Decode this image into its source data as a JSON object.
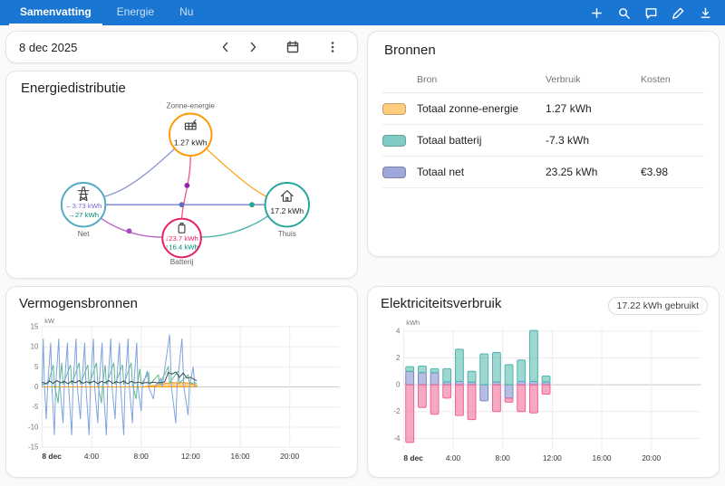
{
  "accent_color": "#1976d2",
  "topbar": {
    "tabs": [
      {
        "label": "Samenvatting",
        "active": true
      },
      {
        "label": "Energie",
        "active": false
      },
      {
        "label": "Nu",
        "active": false
      }
    ]
  },
  "date_bar": {
    "date": "8 dec 2025"
  },
  "energy_distribution": {
    "title": "Energiedistributie",
    "nodes": {
      "solar": {
        "label": "Zonne-energie",
        "value": "1.27 kWh",
        "color": "#ff9800"
      },
      "grid": {
        "label": "Net",
        "color": "#4fa8c4",
        "flows": [
          {
            "text": "←3.73 kWh",
            "color": "#7c66d9"
          },
          {
            "text": "→27 kWh",
            "color": "#00897b"
          }
        ]
      },
      "home": {
        "label": "Thuis",
        "value": "17.2 kWh",
        "color": "#26a69a"
      },
      "battery": {
        "label": "Batterij",
        "color": "#e91e63",
        "flows": [
          {
            "text": "↓23.7 kWh",
            "color": "#e91e63"
          },
          {
            "text": "↑16.4 kWh",
            "color": "#00897b"
          }
        ]
      }
    }
  },
  "sources": {
    "title": "Bronnen",
    "columns": [
      "Bron",
      "Verbruik",
      "Kosten"
    ],
    "rows": [
      {
        "name": "Totaal zonne-energie",
        "consumption": "1.27 kWh",
        "cost": "",
        "color": "#ffcc80"
      },
      {
        "name": "Totaal batterij",
        "consumption": "-7.3 kWh",
        "cost": "",
        "color": "#80cbc4"
      },
      {
        "name": "Totaal net",
        "consumption": "23.25 kWh",
        "cost": "€3.98",
        "color": "#9fa8da"
      }
    ]
  },
  "chart_data": [
    {
      "type": "line",
      "title": "Vermogensbronnen",
      "ylabel": "kW",
      "ylim": [
        -15,
        15
      ],
      "yticks": [
        15,
        10,
        5,
        0,
        -5,
        -10,
        -15
      ],
      "xlim": [
        0,
        24
      ],
      "xticks": [
        {
          "hour": 0,
          "label": "8 dec",
          "bold": true
        },
        {
          "hour": 4,
          "label": "4:00"
        },
        {
          "hour": 8,
          "label": "8:00"
        },
        {
          "hour": 12,
          "label": "12:00"
        },
        {
          "hour": 16,
          "label": "16:00"
        },
        {
          "hour": 20,
          "label": "20:00"
        }
      ],
      "series": [
        {
          "name": "Zonne-energie",
          "color": "#ff9800",
          "fill": true,
          "points": [
            [
              0,
              0
            ],
            [
              8,
              0
            ],
            [
              8.5,
              0.15
            ],
            [
              9,
              0.35
            ],
            [
              9.5,
              0.6
            ],
            [
              10,
              0.9
            ],
            [
              10.5,
              1.1
            ],
            [
              11,
              1.0
            ],
            [
              11.5,
              1.1
            ],
            [
              12,
              0.8
            ],
            [
              12.5,
              0.5
            ]
          ]
        },
        {
          "name": "Thuis",
          "color": "#5bb884",
          "points": [
            [
              0,
              0.6
            ],
            [
              0.5,
              0.8
            ],
            [
              0.9,
              5.5
            ],
            [
              1.0,
              0.6
            ],
            [
              1.3,
              -4
            ],
            [
              1.4,
              0.6
            ],
            [
              1.6,
              6
            ],
            [
              1.7,
              0.6
            ],
            [
              2.3,
              5.5
            ],
            [
              2.4,
              0.6
            ],
            [
              3.0,
              6
            ],
            [
              3.1,
              0.6
            ],
            [
              3.7,
              5.5
            ],
            [
              3.8,
              0.6
            ],
            [
              4.4,
              6
            ],
            [
              4.5,
              0.6
            ],
            [
              4.8,
              -4
            ],
            [
              4.9,
              0.6
            ],
            [
              5.1,
              5.5
            ],
            [
              5.2,
              0.6
            ],
            [
              5.8,
              6
            ],
            [
              5.9,
              0.6
            ],
            [
              6.5,
              5.5
            ],
            [
              6.6,
              0.6
            ],
            [
              7.2,
              6
            ],
            [
              7.3,
              0.6
            ],
            [
              7.6,
              -3
            ],
            [
              7.7,
              0.6
            ],
            [
              7.9,
              4.5
            ],
            [
              8.0,
              0.6
            ],
            [
              8.6,
              3.5
            ],
            [
              8.7,
              0.6
            ],
            [
              9.4,
              3
            ],
            [
              9.5,
              0.7
            ],
            [
              10.2,
              5
            ],
            [
              10.3,
              1
            ],
            [
              11.0,
              4
            ],
            [
              11.1,
              1
            ],
            [
              11.8,
              3
            ],
            [
              11.9,
              1
            ],
            [
              12.5,
              1
            ]
          ]
        },
        {
          "name": "Batterij",
          "color": "#7ba3e0",
          "points": [
            [
              0,
              0
            ],
            [
              0.1,
              12
            ],
            [
              0.2,
              0
            ],
            [
              0.35,
              -8
            ],
            [
              0.45,
              0
            ],
            [
              0.7,
              11
            ],
            [
              0.8,
              0
            ],
            [
              1.0,
              -12
            ],
            [
              1.1,
              0
            ],
            [
              1.35,
              12
            ],
            [
              1.45,
              0
            ],
            [
              1.7,
              -9
            ],
            [
              1.8,
              0
            ],
            [
              2.05,
              11
            ],
            [
              2.15,
              0
            ],
            [
              2.4,
              -12
            ],
            [
              2.5,
              0
            ],
            [
              2.75,
              12
            ],
            [
              2.85,
              0
            ],
            [
              3.1,
              -8
            ],
            [
              3.2,
              0
            ],
            [
              3.45,
              11
            ],
            [
              3.55,
              0
            ],
            [
              3.8,
              -12
            ],
            [
              3.9,
              0
            ],
            [
              4.15,
              12
            ],
            [
              4.25,
              0
            ],
            [
              4.5,
              -9
            ],
            [
              4.6,
              0
            ],
            [
              4.85,
              11
            ],
            [
              4.95,
              0
            ],
            [
              5.2,
              -12
            ],
            [
              5.3,
              0
            ],
            [
              5.55,
              12
            ],
            [
              5.65,
              0
            ],
            [
              5.9,
              -8
            ],
            [
              6.0,
              0
            ],
            [
              6.25,
              11
            ],
            [
              6.35,
              0
            ],
            [
              6.6,
              -12
            ],
            [
              6.7,
              0
            ],
            [
              6.95,
              12
            ],
            [
              7.05,
              0
            ],
            [
              7.3,
              -9
            ],
            [
              7.4,
              0
            ],
            [
              7.65,
              11
            ],
            [
              7.75,
              0
            ],
            [
              8.0,
              -6
            ],
            [
              8.1,
              0
            ],
            [
              8.5,
              4
            ],
            [
              8.6,
              0
            ],
            [
              9.0,
              -3
            ],
            [
              9.1,
              0
            ],
            [
              9.6,
              2
            ],
            [
              9.7,
              0
            ],
            [
              10.3,
              13
            ],
            [
              10.45,
              0
            ],
            [
              10.8,
              -9
            ],
            [
              10.9,
              0
            ],
            [
              11.3,
              12
            ],
            [
              11.45,
              0
            ],
            [
              11.8,
              -7
            ],
            [
              11.9,
              0
            ],
            [
              12.2,
              5
            ],
            [
              12.35,
              0
            ],
            [
              12.5,
              0
            ]
          ]
        },
        {
          "name": "Net",
          "color": "#37474f",
          "points": [
            [
              0,
              1.2
            ],
            [
              0.3,
              0.8
            ],
            [
              0.6,
              1.5
            ],
            [
              0.9,
              0.9
            ],
            [
              1.2,
              1.6
            ],
            [
              1.5,
              1.0
            ],
            [
              1.8,
              1.4
            ],
            [
              2.1,
              0.8
            ],
            [
              2.4,
              1.5
            ],
            [
              2.7,
              1.0
            ],
            [
              3.0,
              1.6
            ],
            [
              3.3,
              0.9
            ],
            [
              3.6,
              1.3
            ],
            [
              3.9,
              1.0
            ],
            [
              4.2,
              1.5
            ],
            [
              4.5,
              0.8
            ],
            [
              4.8,
              1.4
            ],
            [
              5.1,
              1.0
            ],
            [
              5.4,
              1.6
            ],
            [
              5.7,
              0.9
            ],
            [
              6.0,
              1.3
            ],
            [
              6.3,
              1.0
            ],
            [
              6.6,
              1.5
            ],
            [
              6.9,
              0.8
            ],
            [
              7.2,
              1.4
            ],
            [
              7.5,
              1.0
            ],
            [
              7.8,
              1.2
            ],
            [
              8.1,
              0.9
            ],
            [
              8.4,
              1.1
            ],
            [
              8.7,
              1.0
            ],
            [
              9.0,
              1.2
            ],
            [
              9.3,
              1.0
            ],
            [
              9.6,
              1.1
            ],
            [
              9.9,
              1.3
            ],
            [
              10.2,
              3.6
            ],
            [
              10.5,
              3.2
            ],
            [
              10.8,
              3.7
            ],
            [
              11.1,
              2.4
            ],
            [
              11.4,
              3.5
            ],
            [
              11.7,
              2.2
            ],
            [
              12.0,
              2.4
            ],
            [
              12.3,
              1.8
            ],
            [
              12.5,
              1.6
            ]
          ]
        }
      ]
    },
    {
      "type": "bar",
      "title": "Elektriciteitsverbruik",
      "badge": "17.22 kWh gebruikt",
      "ylabel": "kWh",
      "ylim": [
        -4.8,
        4.2
      ],
      "yticks": [
        4,
        2,
        0,
        -2,
        -4
      ],
      "xlim": [
        0,
        24
      ],
      "xticks": [
        {
          "hour": 0,
          "label": "8 dec",
          "bold": true
        },
        {
          "hour": 4,
          "label": "4:00"
        },
        {
          "hour": 8,
          "label": "8:00"
        },
        {
          "hour": 12,
          "label": "12:00"
        },
        {
          "hour": 16,
          "label": "16:00"
        },
        {
          "hour": 20,
          "label": "20:00"
        }
      ],
      "stack_order": [
        "grid",
        "battery_out",
        "battery_in"
      ],
      "colors": {
        "grid": "#7986cb",
        "battery_out": "#4db6ac",
        "battery_in": "#f06292"
      },
      "bars": [
        {
          "hour": 0,
          "grid": 1.0,
          "battery_out": 0.35,
          "battery_in": -4.3
        },
        {
          "hour": 1,
          "grid": 0.9,
          "battery_out": 0.5,
          "battery_in": -1.7
        },
        {
          "hour": 2,
          "grid": 0.9,
          "battery_out": 0.3,
          "battery_in": -2.2
        },
        {
          "hour": 3,
          "grid": 0.2,
          "battery_out": 1.0,
          "battery_in": -1.0
        },
        {
          "hour": 4,
          "grid": 0.25,
          "battery_out": 2.4,
          "battery_in": -2.3
        },
        {
          "hour": 5,
          "grid": 0.2,
          "battery_out": 0.8,
          "battery_in": -2.6
        },
        {
          "hour": 6,
          "grid": -1.2,
          "battery_out": 2.3,
          "battery_in": 0
        },
        {
          "hour": 7,
          "grid": 0.2,
          "battery_out": 2.2,
          "battery_in": -2.0
        },
        {
          "hour": 8,
          "grid": -1.0,
          "battery_out": 1.5,
          "battery_in": -0.3
        },
        {
          "hour": 9,
          "grid": 0.25,
          "battery_out": 1.6,
          "battery_in": -2.0
        },
        {
          "hour": 10,
          "grid": 0.25,
          "battery_out": 3.8,
          "battery_in": -2.1
        },
        {
          "hour": 11,
          "grid": 0.2,
          "battery_out": 0.45,
          "battery_in": -0.7
        }
      ]
    }
  ]
}
